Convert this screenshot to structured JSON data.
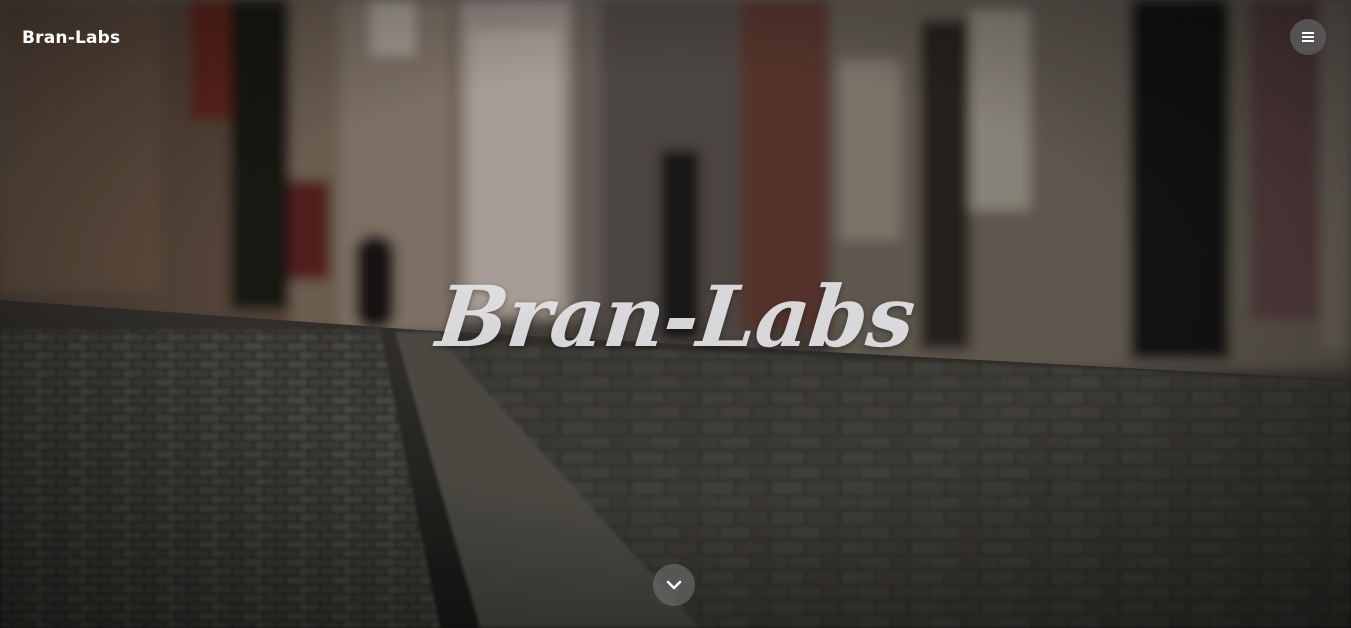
{
  "navbar": {
    "brand": "Bran-Labs",
    "menu_icon": "hamburger-menu-icon"
  },
  "hero": {
    "title": "Bran-Labs",
    "background": "blurred cobblestone street photograph",
    "scroll_icon": "chevron-down-icon"
  },
  "colors": {
    "text": "#ffffff",
    "menu_button_bg": "#5a5a5a",
    "scroll_button_bg": "#787878",
    "dark_overlay": "#1c1b19"
  }
}
